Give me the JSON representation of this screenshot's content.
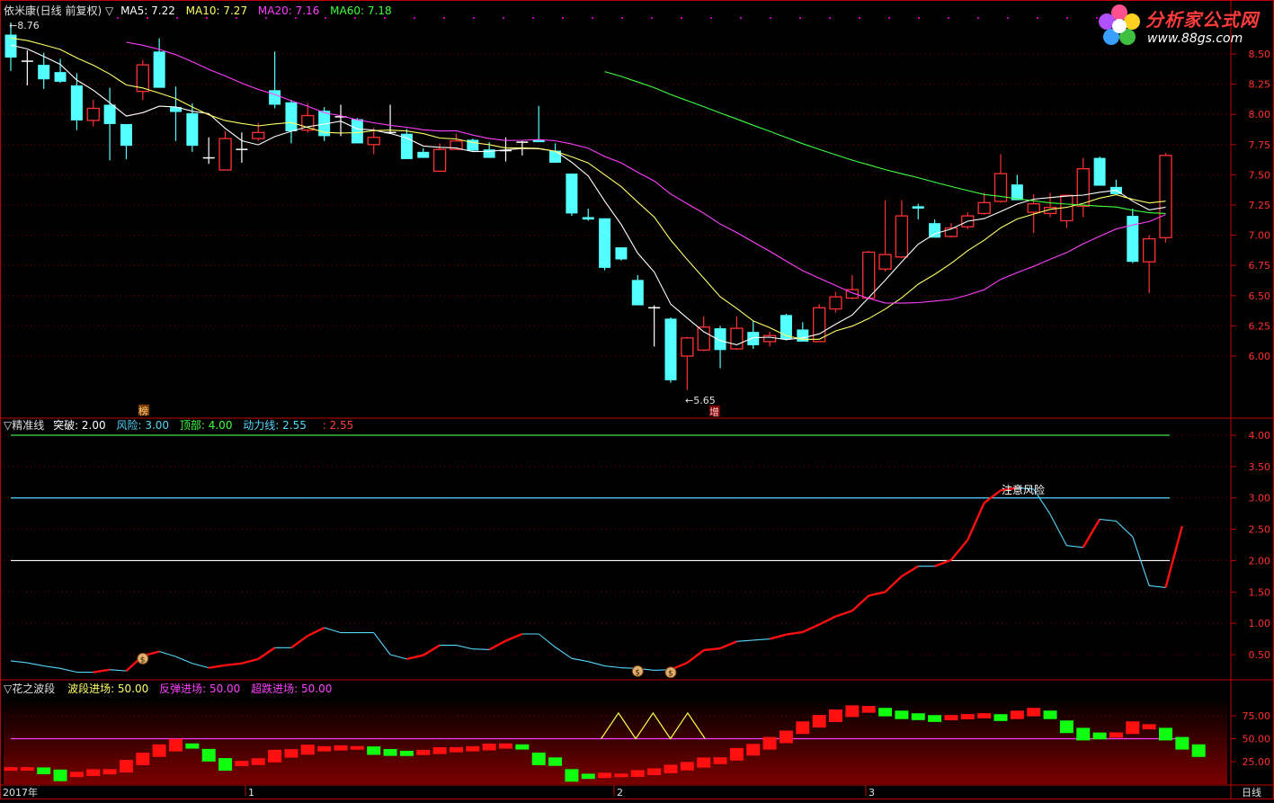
{
  "header": {
    "prefix": "依米康(日线 前复权) ▽",
    "ma5": "MA5: 7.22",
    "ma10": "MA10: 7.27",
    "ma20": "MA20: 7.16",
    "ma60": "MA60: 7.18"
  },
  "logo": {
    "name": "分析家公式网",
    "url": "www.88gs.com"
  },
  "badges": {
    "bang": "榜",
    "zeng": "增"
  },
  "price_labels": {
    "high": "8.76",
    "low": "5.65"
  },
  "panel2": {
    "title": "▽精准线",
    "tupo": "突破: 2.00",
    "fengxian": "风险: 3.00",
    "dingbu": "顶部: 4.00",
    "dongli": "动力线: 2.55",
    "extra": ": 2.55",
    "annotation": "注意风险"
  },
  "panel3": {
    "title": "▽花之波段",
    "boduan": "波段进场: 50.00",
    "fantan": "反弹进场: 50.00",
    "chaodie": "超跌进场: 50.00"
  },
  "xaxis": {
    "labels": [
      "2017年",
      "1",
      "2",
      "3"
    ],
    "period": "日线"
  },
  "colors": {
    "up": "#ff3232",
    "down": "#54ffff",
    "ma5": "#ffffff",
    "ma10": "#ffff66",
    "ma20": "#ff40ff",
    "ma60": "#40ff40",
    "frame": "#c00000"
  },
  "chart_data": [
    {
      "type": "candlestick",
      "title": "依米康(日线 前复权)",
      "y_ticks": [
        "8.50",
        "8.25",
        "8.00",
        "7.75",
        "7.50",
        "7.25",
        "7.00",
        "6.75",
        "6.50",
        "6.25",
        "6.00"
      ],
      "ylim": [
        5.55,
        8.85
      ],
      "ohlc": [
        [
          8.66,
          8.76,
          8.36,
          8.47
        ],
        [
          8.44,
          8.53,
          8.24,
          8.44
        ],
        [
          8.41,
          8.51,
          8.21,
          8.29
        ],
        [
          8.35,
          8.46,
          8.26,
          8.27
        ],
        [
          8.24,
          8.34,
          7.87,
          7.95
        ],
        [
          7.95,
          8.12,
          7.9,
          8.05
        ],
        [
          8.08,
          8.22,
          7.62,
          7.92
        ],
        [
          7.92,
          7.92,
          7.63,
          7.74
        ],
        [
          8.19,
          8.45,
          8.12,
          8.41
        ],
        [
          8.52,
          8.63,
          8.24,
          8.22
        ],
        [
          8.06,
          8.23,
          7.78,
          8.02
        ],
        [
          8.01,
          8.09,
          7.69,
          7.74
        ],
        [
          7.64,
          7.81,
          7.59,
          7.64
        ],
        [
          7.54,
          7.86,
          7.54,
          7.8
        ],
        [
          7.71,
          7.85,
          7.6,
          7.71
        ],
        [
          7.8,
          7.93,
          7.78,
          7.85
        ],
        [
          8.2,
          8.52,
          8.05,
          8.08
        ],
        [
          8.1,
          8.12,
          7.76,
          7.86
        ],
        [
          7.87,
          8.09,
          7.85,
          7.99
        ],
        [
          8.03,
          8.06,
          7.78,
          7.82
        ],
        [
          7.98,
          8.08,
          7.82,
          7.97
        ],
        [
          7.96,
          7.97,
          7.76,
          7.76
        ],
        [
          7.75,
          7.89,
          7.67,
          7.81
        ],
        [
          7.85,
          8.08,
          7.84,
          7.85
        ],
        [
          7.84,
          7.88,
          7.63,
          7.63
        ],
        [
          7.69,
          7.72,
          7.64,
          7.64
        ],
        [
          7.53,
          7.76,
          7.53,
          7.71
        ],
        [
          7.71,
          7.84,
          7.72,
          7.78
        ],
        [
          7.79,
          7.8,
          7.69,
          7.7
        ],
        [
          7.71,
          7.77,
          7.64,
          7.64
        ],
        [
          7.69,
          7.81,
          7.61,
          7.7
        ],
        [
          7.77,
          7.78,
          7.66,
          7.77
        ],
        [
          7.79,
          8.07,
          7.77,
          7.77
        ],
        [
          7.7,
          7.76,
          7.6,
          7.6
        ],
        [
          7.51,
          7.51,
          7.16,
          7.18
        ],
        [
          7.15,
          7.22,
          7.12,
          7.13
        ],
        [
          7.14,
          7.14,
          6.71,
          6.73
        ],
        [
          6.9,
          6.9,
          6.79,
          6.8
        ],
        [
          6.63,
          6.67,
          6.43,
          6.42
        ],
        [
          6.4,
          6.42,
          6.08,
          6.4
        ],
        [
          6.31,
          6.32,
          5.78,
          5.8
        ],
        [
          6.0,
          6.16,
          5.72,
          6.15
        ],
        [
          6.05,
          6.33,
          6.04,
          6.24
        ],
        [
          6.23,
          6.25,
          5.9,
          6.05
        ],
        [
          6.06,
          6.33,
          6.05,
          6.23
        ],
        [
          6.2,
          6.29,
          6.06,
          6.09
        ],
        [
          6.12,
          6.2,
          6.08,
          6.17
        ],
        [
          6.34,
          6.35,
          6.13,
          6.14
        ],
        [
          6.22,
          6.28,
          6.12,
          6.12
        ],
        [
          6.12,
          6.43,
          6.12,
          6.4
        ],
        [
          6.39,
          6.53,
          6.36,
          6.49
        ],
        [
          6.48,
          6.67,
          6.47,
          6.55
        ],
        [
          6.48,
          6.87,
          6.47,
          6.86
        ],
        [
          6.72,
          7.29,
          6.7,
          6.84
        ],
        [
          6.82,
          7.29,
          6.81,
          7.16
        ],
        [
          7.24,
          7.26,
          7.13,
          7.22
        ],
        [
          7.1,
          7.13,
          6.99,
          6.98
        ],
        [
          6.99,
          7.1,
          6.98,
          7.06
        ],
        [
          7.07,
          7.19,
          7.05,
          7.16
        ],
        [
          7.18,
          7.35,
          7.17,
          7.27
        ],
        [
          7.28,
          7.67,
          7.27,
          7.51
        ],
        [
          7.42,
          7.5,
          7.29,
          7.29
        ],
        [
          7.19,
          7.34,
          7.02,
          7.26
        ],
        [
          7.18,
          7.35,
          7.15,
          7.23
        ],
        [
          7.12,
          7.3,
          7.06,
          7.33
        ],
        [
          7.24,
          7.64,
          7.15,
          7.55
        ],
        [
          7.64,
          7.65,
          7.44,
          7.41
        ],
        [
          7.4,
          7.46,
          7.34,
          7.34
        ],
        [
          7.16,
          7.22,
          6.77,
          6.78
        ],
        [
          6.78,
          7.0,
          6.52,
          6.97
        ],
        [
          6.98,
          7.68,
          6.94,
          7.66
        ]
      ]
    },
    {
      "type": "line",
      "title": "精准线",
      "y_ticks": [
        "4.00",
        "3.50",
        "3.00",
        "2.50",
        "2.00",
        "1.50",
        "1.00",
        "0.50"
      ],
      "ylim": [
        0.2,
        4.25
      ],
      "reference_lines": [
        4.0,
        3.0,
        2.0
      ],
      "values": [
        0.4,
        0.37,
        0.32,
        0.28,
        0.22,
        0.22,
        0.26,
        0.24,
        0.48,
        0.55,
        0.47,
        0.36,
        0.29,
        0.33,
        0.36,
        0.43,
        0.61,
        0.61,
        0.8,
        0.93,
        0.85,
        0.85,
        0.85,
        0.5,
        0.43,
        0.49,
        0.65,
        0.65,
        0.59,
        0.58,
        0.72,
        0.83,
        0.83,
        0.62,
        0.44,
        0.39,
        0.32,
        0.29,
        0.28,
        0.25,
        0.26,
        0.37,
        0.57,
        0.6,
        0.71,
        0.73,
        0.75,
        0.82,
        0.86,
        0.98,
        1.11,
        1.2,
        1.44,
        1.5,
        1.75,
        1.91,
        1.91,
        2.01,
        2.33,
        2.92,
        3.12,
        3.16,
        3.14,
        2.74,
        2.24,
        2.21,
        2.66,
        2.63,
        2.38,
        1.6,
        1.57,
        2.55
      ],
      "markers_at": [
        8,
        38,
        40
      ]
    },
    {
      "type": "bar",
      "title": "花之波段",
      "y_ticks": [
        "75.00",
        "50.00",
        "25.00"
      ],
      "ylim": [
        0,
        100
      ],
      "reference_line": 50,
      "values": [
        17,
        17,
        15,
        10,
        11,
        13,
        14,
        20,
        28,
        37,
        43,
        42,
        32,
        22,
        23,
        25,
        31,
        34,
        38,
        39,
        40,
        40,
        37,
        35,
        34,
        35,
        37,
        38,
        39,
        41,
        42,
        41,
        28,
        25,
        10,
        9,
        10,
        10,
        12,
        14,
        17,
        20,
        24,
        26,
        33,
        38,
        45,
        52,
        62,
        69,
        75,
        80,
        82,
        79,
        76,
        74,
        72,
        73,
        74,
        75,
        73,
        76,
        79,
        76,
        63,
        55,
        53,
        54,
        62,
        63,
        55,
        45,
        37
      ]
    }
  ]
}
